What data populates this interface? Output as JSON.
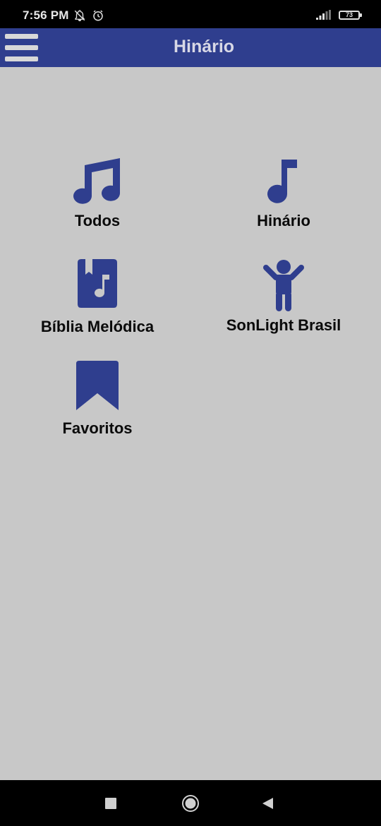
{
  "status_bar": {
    "time": "7:56 PM",
    "battery": "73",
    "icons": [
      "notifications-off-icon",
      "alarm-icon",
      "signal-icon",
      "battery-icon"
    ]
  },
  "app_bar": {
    "title": "Hinário",
    "menu_icon": "hamburger-menu-icon"
  },
  "menu_items": [
    {
      "label": "Todos",
      "icon": "music-notes-icon"
    },
    {
      "label": "Hinário",
      "icon": "music-note-icon"
    },
    {
      "label": "Bíblia Melódica",
      "icon": "music-book-icon"
    },
    {
      "label": "SonLight Brasil",
      "icon": "child-icon"
    },
    {
      "label": "Favoritos",
      "icon": "bookmark-icon"
    }
  ],
  "nav_bar": {
    "icons": [
      "recent-apps-icon",
      "home-icon",
      "back-icon"
    ]
  },
  "colors": {
    "primary": "#2f3e8e",
    "background": "#c8c8c8",
    "icon": "#2f3e8e"
  }
}
